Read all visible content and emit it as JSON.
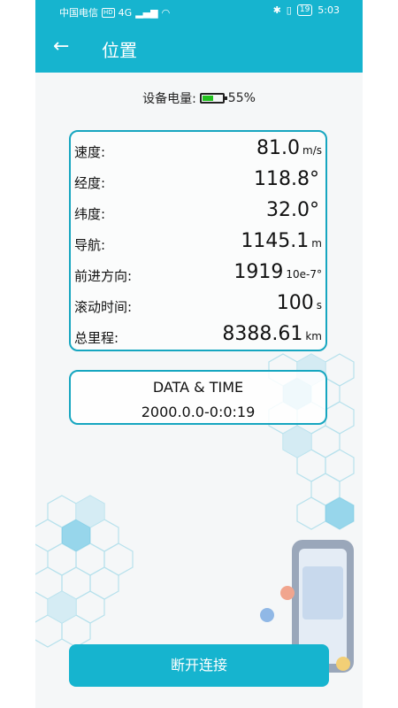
{
  "statusbar": {
    "carrier": "中国电信",
    "hd": "HD",
    "net": "4G",
    "time": "5:03",
    "battery": "19"
  },
  "appbar": {
    "title": "位置"
  },
  "device": {
    "battery_label": "设备电量:",
    "battery_percent": "55%",
    "battery_level": 0.55
  },
  "metrics": [
    {
      "label": "速度:",
      "value": "81.0",
      "unit": "m/s"
    },
    {
      "label": "经度:",
      "value": "118.8°",
      "unit": ""
    },
    {
      "label": "纬度:",
      "value": "32.0°",
      "unit": ""
    },
    {
      "label": "导航:",
      "value": "1145.1",
      "unit": "m"
    },
    {
      "label": "前进方向:",
      "value": "1919",
      "unit": "10e-7°"
    },
    {
      "label": "滚动时间:",
      "value": "100",
      "unit": "s"
    },
    {
      "label": "总里程:",
      "value": "8388.61",
      "unit": "km"
    }
  ],
  "datetime": {
    "title": "DATA & TIME",
    "value": "2000.0.0-0:0:19"
  },
  "actions": {
    "disconnect": "断开连接"
  },
  "colors": {
    "accent": "#16b4cf",
    "border": "#16a6c0",
    "battery_fill": "#22c11f"
  }
}
